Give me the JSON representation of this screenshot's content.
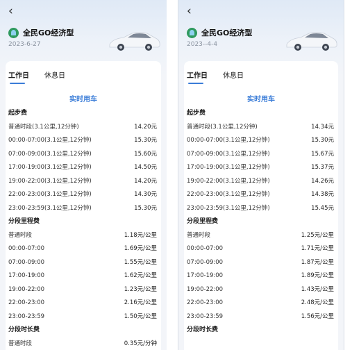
{
  "left": {
    "back_icon": "chevron-left-icon",
    "title": "全民GO经济型",
    "date": "2023-6-27",
    "tabs": [
      {
        "label": "工作日",
        "active": true
      },
      {
        "label": "休息日",
        "active": false
      }
    ],
    "mode": "实时用车",
    "sections": [
      {
        "title": "起步费",
        "rows": [
          {
            "label": "普通时段(3.1公里,12分钟)",
            "value": "14.20元"
          },
          {
            "label": "00:00-07:00(3.1公里,12分钟)",
            "value": "15.30元"
          },
          {
            "label": "07:00-09:00(3.1公里,12分钟)",
            "value": "15.60元"
          },
          {
            "label": "17:00-19:00(3.1公里,12分钟)",
            "value": "14.50元"
          },
          {
            "label": "19:00-22:00(3.1公里,12分钟)",
            "value": "14.20元"
          },
          {
            "label": "22:00-23:00(3.1公里,12分钟)",
            "value": "14.30元"
          },
          {
            "label": "23:00-23:59(3.1公里,12分钟)",
            "value": "15.30元"
          }
        ]
      },
      {
        "title": "分段里程费",
        "rows": [
          {
            "label": "普通时段",
            "value": "1.18元/公里"
          },
          {
            "label": "00:00-07:00",
            "value": "1.69元/公里"
          },
          {
            "label": "07:00-09:00",
            "value": "1.55元/公里"
          },
          {
            "label": "17:00-19:00",
            "value": "1.62元/公里"
          },
          {
            "label": "19:00-22:00",
            "value": "1.23元/公里"
          },
          {
            "label": "22:00-23:00",
            "value": "2.16元/公里"
          },
          {
            "label": "23:00-23:59",
            "value": "1.50元/公里"
          }
        ]
      },
      {
        "title": "分段时长费",
        "rows": [
          {
            "label": "普通时段",
            "value": "0.35元/分钟"
          }
        ]
      }
    ]
  },
  "right": {
    "back_icon": "chevron-left-icon",
    "title": "全民GO经济型",
    "date": "2023--4-4",
    "tabs": [
      {
        "label": "工作日",
        "active": true
      },
      {
        "label": "休息日",
        "active": false
      }
    ],
    "mode": "实时用车",
    "sections": [
      {
        "title": "起步费",
        "rows": [
          {
            "label": "普通时段(3.1公里,12分钟)",
            "value": "14.34元"
          },
          {
            "label": "00:00-07:00(3.1公里,12分钟)",
            "value": "15.30元"
          },
          {
            "label": "07:00-09:00(3.1公里,12分钟)",
            "value": "15.67元"
          },
          {
            "label": "17:00-19:00(3.1公里,12分钟)",
            "value": "15.37元"
          },
          {
            "label": "19:00-22:00(3.1公里,12分钟)",
            "value": "14.26元"
          },
          {
            "label": "22:00-23:00(3.1公里,12分钟)",
            "value": "14.38元"
          },
          {
            "label": "23:00-23:59(3.1公里,12分钟)",
            "value": "15.45元"
          }
        ]
      },
      {
        "title": "分段里程费",
        "rows": [
          {
            "label": "普通时段",
            "value": "1.25元/公里"
          },
          {
            "label": "00:00-07:00",
            "value": "1.71元/公里"
          },
          {
            "label": "07:00-09:00",
            "value": "1.87元/公里"
          },
          {
            "label": "17:00-19:00",
            "value": "1.89元/公里"
          },
          {
            "label": "19:00-22:00",
            "value": "1.43元/公里"
          },
          {
            "label": "22:00-23:00",
            "value": "2.48元/公里"
          },
          {
            "label": "23:00-23:59",
            "value": "1.56元/公里"
          }
        ]
      },
      {
        "title": "分段时长费",
        "rows": []
      }
    ]
  }
}
